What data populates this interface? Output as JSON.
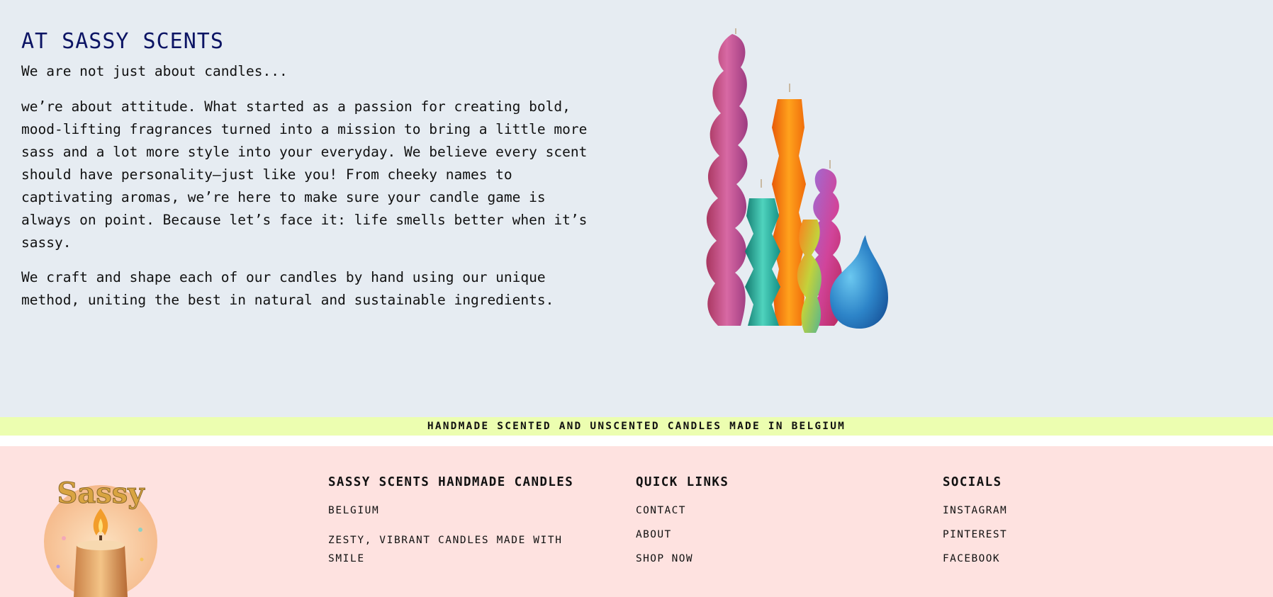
{
  "about": {
    "title": "AT SASSY SCENTS",
    "subtitle": "We are not just about candles...",
    "paragraph_1": "we’re about attitude. What started as a passion for creating bold, mood-lifting fragrances turned into a mission to bring a little more sass and a lot more style into your everyday. We believe every scent should have personality—just like you! From cheeky names to captivating aromas, we’re here to make sure your candle game is always on point. Because let’s face it: life smells better when it’s sassy.",
    "paragraph_2": "We craft and shape each of our candles by hand using our unique method, uniting the best in natural and sustainable ingredients."
  },
  "band": {
    "text": "HANDMADE SCENTED AND UNSCENTED CANDLES MADE IN BELGIUM"
  },
  "footer": {
    "logo_text": "Sassy",
    "brand": {
      "title": "SASSY SCENTS HANDMADE CANDLES",
      "location": "BELGIUM",
      "tagline": "ZESTY, VIBRANT CANDLES MADE WITH SMILE"
    },
    "quick_links": {
      "title": "QUICK LINKS",
      "items": [
        "CONTACT",
        "ABOUT",
        "SHOP NOW"
      ]
    },
    "socials": {
      "title": "SOCIALS",
      "items": [
        "INSTAGRAM",
        "PINTEREST",
        "FACEBOOK"
      ]
    }
  },
  "colors": {
    "about_bg": "#e6ecf2",
    "title": "#0c1464",
    "band_bg": "#ecfeb0",
    "footer_bg": "#fee2e0"
  }
}
